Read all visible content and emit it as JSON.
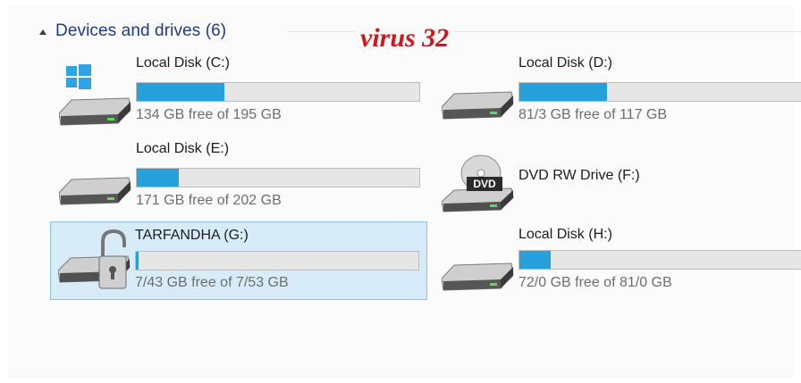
{
  "section": {
    "title": "Devices and drives (6)"
  },
  "watermark": "virus 32",
  "colors": {
    "title": "#1e3a8a",
    "bar_fill": "#26a0da",
    "watermark": "#d4141b",
    "selection": "#d7ecf8"
  },
  "drives": [
    {
      "label": "Local Disk (C:)",
      "capacity": "134 GB free of 195 GB",
      "used_fraction": 0.31,
      "icon": "windows-system-drive-icon"
    },
    {
      "label": "Local Disk (D:)",
      "capacity": "81/3 GB free of 117 GB",
      "used_fraction": 0.31,
      "icon": "hard-drive-icon"
    },
    {
      "label": "Local Disk (E:)",
      "capacity": "171 GB free of 202 GB",
      "used_fraction": 0.15,
      "icon": "hard-drive-icon"
    },
    {
      "label": "DVD RW Drive (F:)",
      "icon": "dvd-drive-icon",
      "dvd_badge": "DVD"
    },
    {
      "label": "TARFANDHA (G:)",
      "capacity": "7/43 GB free of 7/53 GB",
      "used_fraction": 0.01,
      "icon": "locked-drive-icon",
      "selected": true
    },
    {
      "label": "Local Disk (H:)",
      "capacity": "72/0 GB free of 81/0 GB",
      "used_fraction": 0.11,
      "icon": "hard-drive-icon"
    }
  ]
}
